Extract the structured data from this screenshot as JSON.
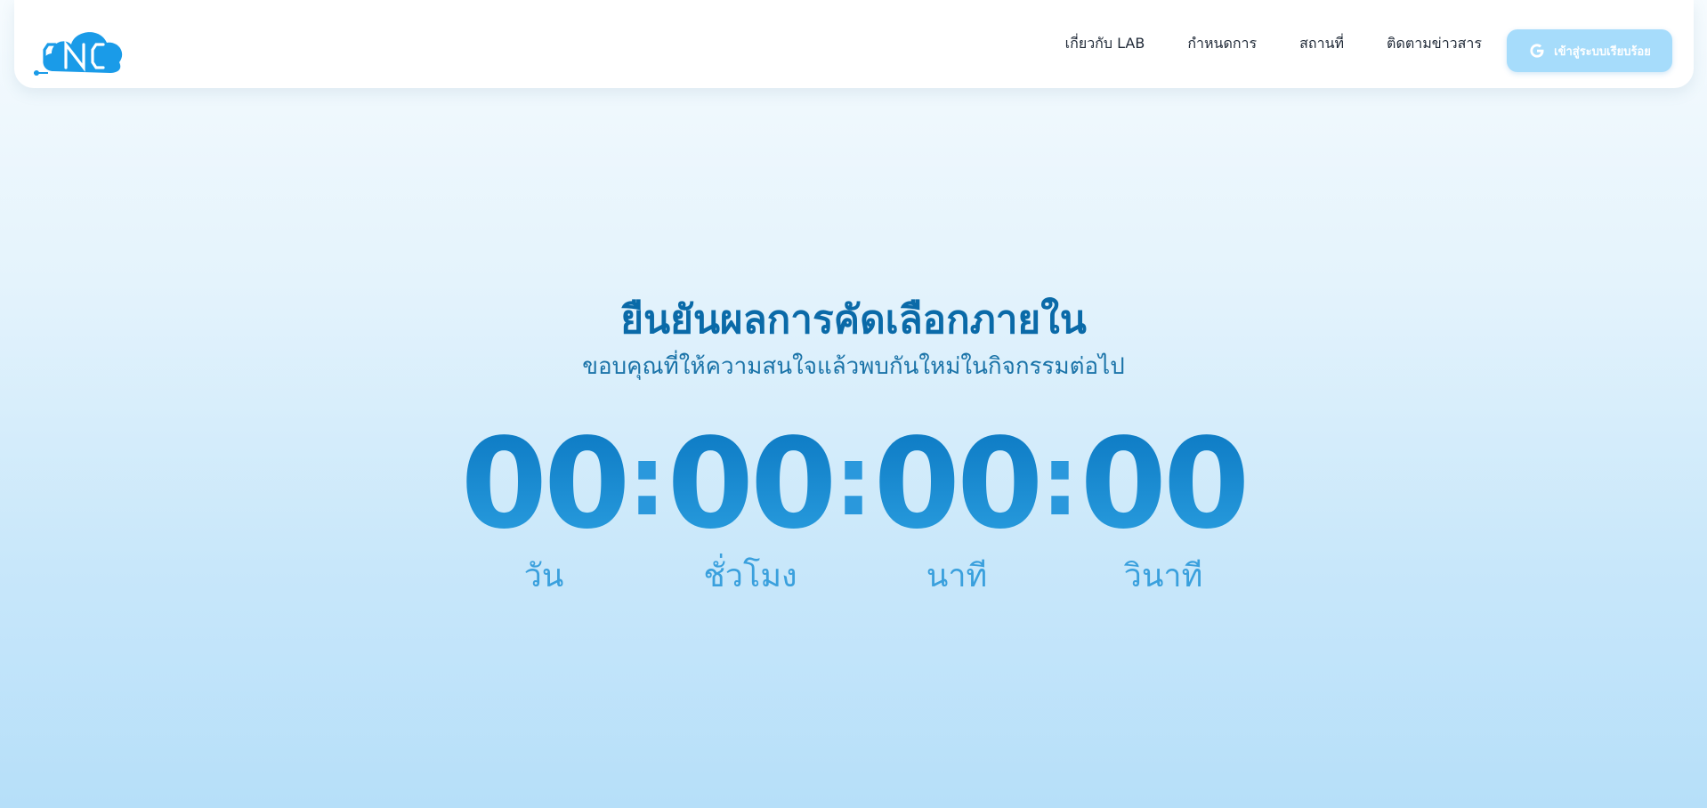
{
  "header": {
    "logo_text": "CNC",
    "nav_items": [
      "เกี่ยวกับ LAB",
      "กำหนดการ",
      "สถานที่",
      "ติดตามข่าวสาร"
    ],
    "login_button": {
      "icon": "google-icon",
      "label": "เข้าสู่ระบบเรียบร้อย"
    }
  },
  "hero": {
    "title": "ยืนยันผลการคัดเลือกภายใน",
    "subtitle": "ขอบคุณที่ให้ความสนใจแล้วพบกันใหม่ในกิจกรรมต่อไป"
  },
  "countdown": {
    "separator": ":",
    "units": [
      {
        "value": "00",
        "label": "วัน"
      },
      {
        "value": "00",
        "label": "ชั่วโมง"
      },
      {
        "value": "00",
        "label": "นาที"
      },
      {
        "value": "00",
        "label": "วินาที"
      }
    ]
  },
  "colors": {
    "brand_blue": "#1a9be8",
    "title": "#0a6aa8",
    "button_bg": "#a6dcfb"
  }
}
